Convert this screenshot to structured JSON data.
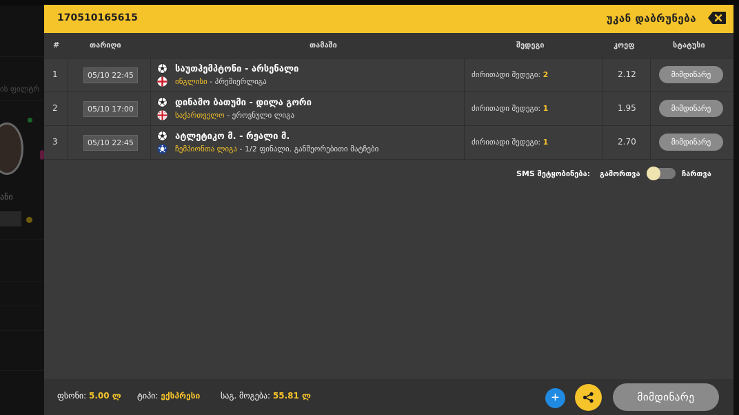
{
  "background": {
    "filter_text": "ის ფილტრ",
    "user_name": "ანი"
  },
  "modal": {
    "ticket_id": "170510165615",
    "back_label": "უკან დაბრუნება",
    "columns": {
      "num": "#",
      "date": "თარიღი",
      "game": "თამაში",
      "outcome": "შედეგი",
      "odds": "კოეფ",
      "status": "სტატუსი"
    },
    "rows": [
      {
        "num": "1",
        "date": "05/10 22:45",
        "match": "საუთჰემპტონი - არსენალი",
        "country": "ინგლისი",
        "league": " - პრემიერლიგა",
        "flag": "england-flag",
        "outcome_label": "ძირითადი შედეგი: ",
        "outcome_value": "2",
        "odds": "2.12",
        "status": "მიმდინარე"
      },
      {
        "num": "2",
        "date": "05/10 17:00",
        "match": "დინამო ბათუმი - დილა გორი",
        "country": "საქართველო",
        "league": " - ეროვნული ლიგა",
        "flag": "georgia-flag",
        "outcome_label": "ძირითადი შედეგი: ",
        "outcome_value": "1",
        "odds": "1.95",
        "status": "მიმდინარე"
      },
      {
        "num": "3",
        "date": "05/10 22:45",
        "match": "ატლეტიკო მ. - რეალი მ.",
        "country": "ჩემპიონთა ლიგა",
        "league": " - 1/2 ფინალი. განმეორებითი მატჩები",
        "flag": "champions-league-icon",
        "outcome_label": "ძირითადი შედეგი: ",
        "outcome_value": "1",
        "odds": "2.70",
        "status": "მიმდინარე"
      }
    ],
    "sms": {
      "label": "SMS შეტყობინება:",
      "off_label": "გამორთვა",
      "on_label": "ჩართვა",
      "enabled": false
    },
    "footer": {
      "stake_label": "ფსონი:",
      "stake_value": "5.00 ლ",
      "type_label": "ტიპი:",
      "type_value": "ექსპრესი",
      "win_label": "საგ. მოგება:",
      "win_value": "55.81 ლ",
      "plus_label": "+",
      "status_label": "მიმდინარე"
    }
  },
  "colors": {
    "accent": "#f5c32a",
    "status_gray": "#8a8a8a",
    "plus_blue": "#1f8ae0"
  }
}
